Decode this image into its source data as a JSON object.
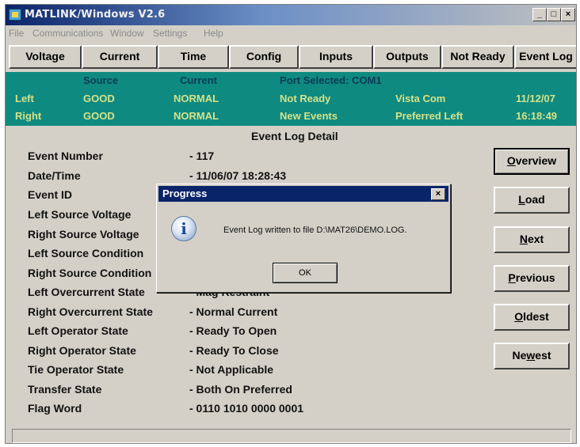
{
  "window": {
    "title": "MATLINK/Windows V2.6"
  },
  "menu": [
    "File",
    "Communications",
    "Window",
    "Settings",
    "Help"
  ],
  "toolbar": [
    "Voltage",
    "Current",
    "Time",
    "Config",
    "Inputs",
    "Outputs",
    "Not Ready",
    "Event Log"
  ],
  "status": {
    "headers": {
      "source": "Source",
      "current": "Current",
      "port": "Port Selected: COM1"
    },
    "left": {
      "label": "Left",
      "source": "GOOD",
      "current": "NORMAL",
      "state": "Not Ready",
      "mode": "Vista Com",
      "date": "11/12/07"
    },
    "right": {
      "label": "Right",
      "source": "GOOD",
      "current": "NORMAL",
      "state": "New Events",
      "mode": "Preferred Left",
      "time": "16:18:49"
    }
  },
  "detail": {
    "title": "Event Log Detail",
    "fields": [
      {
        "label": "Event Number",
        "value": "- 117"
      },
      {
        "label": "Date/Time",
        "value": "- 11/06/07  18:28:43"
      },
      {
        "label": "Event ID",
        "value": ""
      },
      {
        "label": "Left Source Voltage",
        "value": ""
      },
      {
        "label": "Right Source Voltage",
        "value": ""
      },
      {
        "label": "Left Source Condition",
        "value": ""
      },
      {
        "label": "Right Source Condition",
        "value": ""
      },
      {
        "label": "Left Overcurrent State",
        "value": "- Mag Restraint"
      },
      {
        "label": "Right Overcurrent State",
        "value": "- Normal Current"
      },
      {
        "label": "Left Operator State",
        "value": "- Ready To Open"
      },
      {
        "label": "Right Operator State",
        "value": "- Ready To Close"
      },
      {
        "label": "Tie Operator State",
        "value": "- Not Applicable"
      },
      {
        "label": "Transfer State",
        "value": "- Both On Preferred"
      },
      {
        "label": "Flag Word",
        "value": "- 0110 1010 0000 0001"
      }
    ]
  },
  "side_buttons": [
    {
      "first": "O",
      "rest": "verview"
    },
    {
      "first": "L",
      "rest": "oad"
    },
    {
      "first": "N",
      "rest": "ext"
    },
    {
      "first": "P",
      "rest": "revious"
    },
    {
      "first": "O",
      "rest": "ldest"
    },
    {
      "pre": "Ne",
      "first": "w",
      "rest": "est"
    }
  ],
  "dialog": {
    "title": "Progress",
    "close_glyph": "×",
    "icon": "info-icon",
    "icon_glyph": "i",
    "message": "Event Log written to file D:\\MAT26\\DEMO.LOG.",
    "ok_label": "OK"
  },
  "caption_glyphs": {
    "minimize": "_",
    "maximize": "□",
    "close": "×"
  }
}
